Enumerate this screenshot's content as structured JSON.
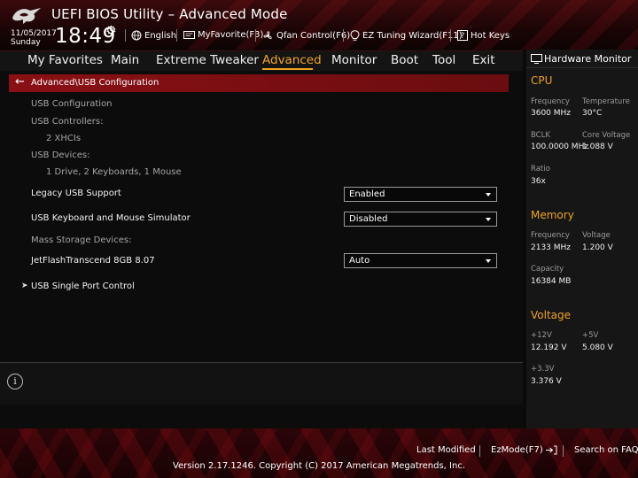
{
  "header": {
    "app_title": "UEFI BIOS Utility – Advanced Mode",
    "date": "11/05/2017",
    "day": "Sunday",
    "time": "18:49",
    "toolbar": [
      {
        "label": "English",
        "icon": "globe-icon"
      },
      {
        "label": "MyFavorite(F3)",
        "icon": "favorite-icon"
      },
      {
        "label": "Qfan Control(F6)",
        "icon": "fan-icon"
      },
      {
        "label": "EZ Tuning Wizard(F11)",
        "icon": "bulb-icon"
      },
      {
        "label": "Hot Keys",
        "icon": "question-icon"
      }
    ]
  },
  "menu": {
    "tabs": [
      "My Favorites",
      "Main",
      "Extreme Tweaker",
      "Advanced",
      "Monitor",
      "Boot",
      "Tool",
      "Exit"
    ],
    "active": "Advanced"
  },
  "breadcrumb": "Advanced\\USB Configuration",
  "settings": {
    "usb_configuration_heading": "USB Configuration",
    "usb_controllers_label": "USB Controllers:",
    "usb_controllers_value": "2 XHCIs",
    "usb_devices_label": "USB Devices:",
    "usb_devices_value": "1 Drive, 2 Keyboards, 1 Mouse",
    "legacy_usb_label": "Legacy USB Support",
    "legacy_usb_value": "Enabled",
    "kbm_sim_label": "USB Keyboard and Mouse Simulator",
    "kbm_sim_value": "Disabled",
    "mass_storage_label": "Mass Storage Devices:",
    "jetflash_label": "JetFlashTranscend 8GB 8.07",
    "jetflash_value": "Auto",
    "single_port_label": "USB Single Port Control"
  },
  "hardware_monitor": {
    "title": "Hardware Monitor",
    "cpu": {
      "heading": "CPU",
      "frequency_label": "Frequency",
      "frequency_value": "3600 MHz",
      "temperature_label": "Temperature",
      "temperature_value": "30°C",
      "bclk_label": "BCLK",
      "bclk_value": "100.0000 MHz",
      "core_voltage_label": "Core Voltage",
      "core_voltage_value": "1.088 V",
      "ratio_label": "Ratio",
      "ratio_value": "36x"
    },
    "memory": {
      "heading": "Memory",
      "frequency_label": "Frequency",
      "frequency_value": "2133 MHz",
      "voltage_label": "Voltage",
      "voltage_value": "1.200 V",
      "capacity_label": "Capacity",
      "capacity_value": "16384 MB"
    },
    "voltage": {
      "heading": "Voltage",
      "v12_label": "+12V",
      "v12_value": "12.192 V",
      "v5_label": "+5V",
      "v5_value": "5.080 V",
      "v33_label": "+3.3V",
      "v33_value": "3.376 V"
    }
  },
  "footer": {
    "last_modified": "Last Modified",
    "ezmode": "EzMode(F7)",
    "search_faq": "Search on FAQ",
    "copyright": "Version 2.17.1246. Copyright (C) 2017 American Megatrends, Inc."
  },
  "colors": {
    "accent": "#f0a422",
    "breadcrumb_bar": "#8a1014",
    "background": "#0c0c0c"
  }
}
